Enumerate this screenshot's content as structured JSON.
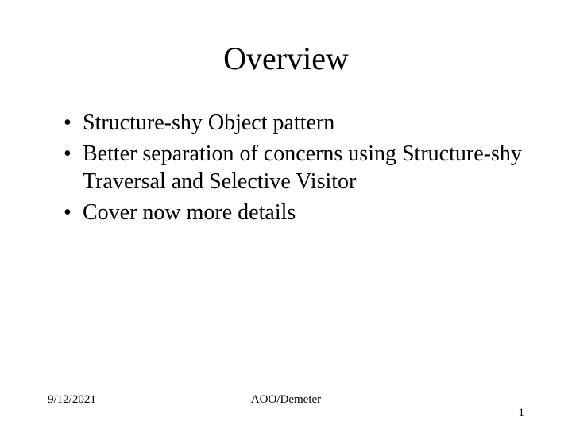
{
  "title": "Overview",
  "bullets": [
    "Structure-shy Object pattern",
    "Better separation of concerns using Structure-shy Traversal and Selective Visitor",
    "Cover now more details"
  ],
  "footer": {
    "date": "9/12/2021",
    "center": "AOO/Demeter",
    "page": "1"
  }
}
